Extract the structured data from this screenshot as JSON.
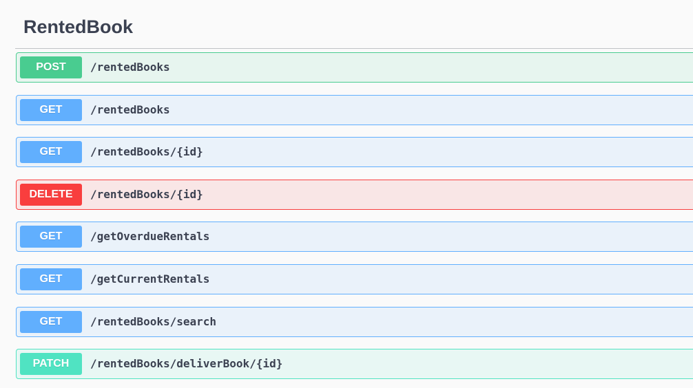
{
  "section": {
    "title": "RentedBook"
  },
  "operations": [
    {
      "method": "POST",
      "path": "/rentedBooks"
    },
    {
      "method": "GET",
      "path": "/rentedBooks"
    },
    {
      "method": "GET",
      "path": "/rentedBooks/{id}"
    },
    {
      "method": "DELETE",
      "path": "/rentedBooks/{id}"
    },
    {
      "method": "GET",
      "path": "/getOverdueRentals"
    },
    {
      "method": "GET",
      "path": "/getCurrentRentals"
    },
    {
      "method": "GET",
      "path": "/rentedBooks/search"
    },
    {
      "method": "PATCH",
      "path": "/rentedBooks/deliverBook/{id}"
    }
  ],
  "colors": {
    "POST": "#49cc90",
    "GET": "#61affe",
    "DELETE": "#f93e3e",
    "PATCH": "#50e3c2",
    "text": "#3b4151"
  }
}
